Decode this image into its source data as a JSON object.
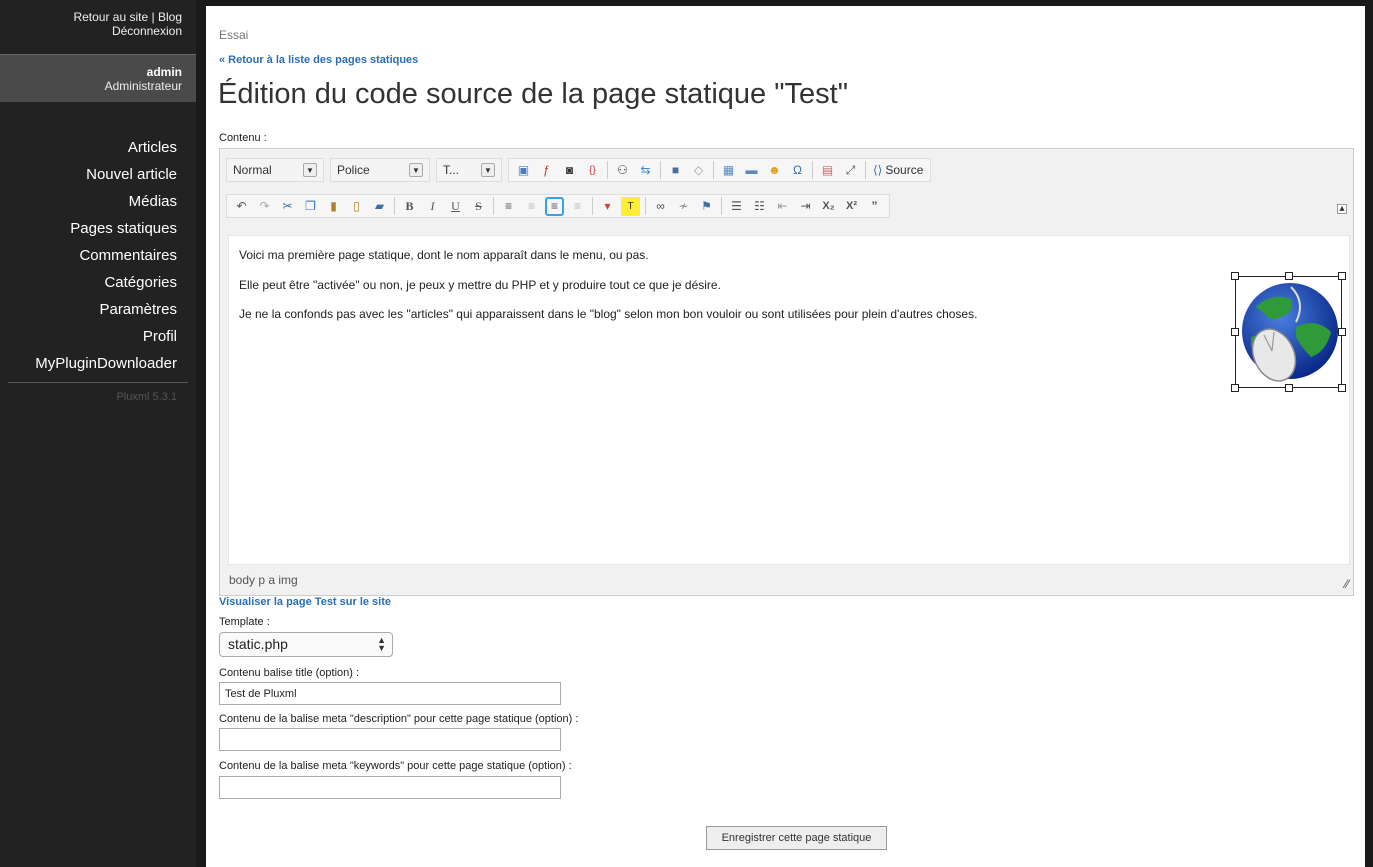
{
  "sidebar": {
    "site_link": "Retour au site",
    "separator": "|",
    "blog_link": "Blog",
    "logout": "Déconnexion",
    "user_name": "admin",
    "user_role": "Administrateur",
    "nav": [
      "Articles",
      "Nouvel article",
      "Médias",
      "Pages statiques",
      "Commentaires",
      "Catégories",
      "Paramètres",
      "Profil",
      "MyPluginDownloader"
    ],
    "version": "Pluxml 5.3.1"
  },
  "main": {
    "breadcrumb": "Essai",
    "back_link": "« Retour à la liste des pages statiques",
    "title": "Édition du code source de la page statique \"Test\"",
    "content_label": "Contenu :"
  },
  "editor": {
    "format_combo": "Normal",
    "font_combo": "Police",
    "size_combo": "T...",
    "source_label": "Source",
    "paragraphs": [
      "Voici ma première page statique, dont le nom apparaît dans le menu, ou pas.",
      "Elle peut être \"activée\" ou non, je peux y mettre du PHP et y produire tout ce que je désire.",
      "Je ne la confonds pas avec les \"articles\" qui apparaissent dans le \"blog\" selon mon bon vouloir ou sont utilisées pour plein d'autres choses."
    ],
    "element_path": "body  p  a  img",
    "icons_row1": [
      "image-icon",
      "flash-icon",
      "camera-icon",
      "code-icon",
      "binoculars-icon",
      "replace-icon",
      "block-icon",
      "eraser-icon",
      "table-icon",
      "hr-icon",
      "smiley-icon",
      "omega-icon",
      "iframe-icon",
      "maximize-icon"
    ],
    "icons_row2": [
      "undo-icon",
      "redo-icon",
      "cut-icon",
      "copy-icon",
      "paste-icon",
      "paste-text-icon",
      "paste-word-icon",
      "bold-icon",
      "italic-icon",
      "underline-icon",
      "strike-icon",
      "align-left-icon",
      "align-center-icon",
      "align-right-icon",
      "align-justify-icon",
      "text-color-icon",
      "bg-color-icon",
      "link-icon",
      "unlink-icon",
      "anchor-icon",
      "numbered-list-icon",
      "bulleted-list-icon",
      "outdent-icon",
      "indent-icon",
      "subscript-icon",
      "superscript-icon",
      "blockquote-icon"
    ]
  },
  "form": {
    "view_link": "Visualiser la page Test sur le site",
    "template_label": "Template :",
    "template_value": "static.php",
    "title_label": "Contenu balise title (option) :",
    "title_value": "Test de Pluxml",
    "description_label": "Contenu de la balise meta \"description\" pour cette page statique (option) :",
    "description_value": "",
    "keywords_label": "Contenu de la balise meta \"keywords\" pour cette page statique (option) :",
    "keywords_value": "",
    "save_label": "Enregistrer cette page statique"
  },
  "colors": {
    "link": "#2a6fb4",
    "sidebar_bg": "#222222",
    "user_bg": "#4a4a4a"
  }
}
